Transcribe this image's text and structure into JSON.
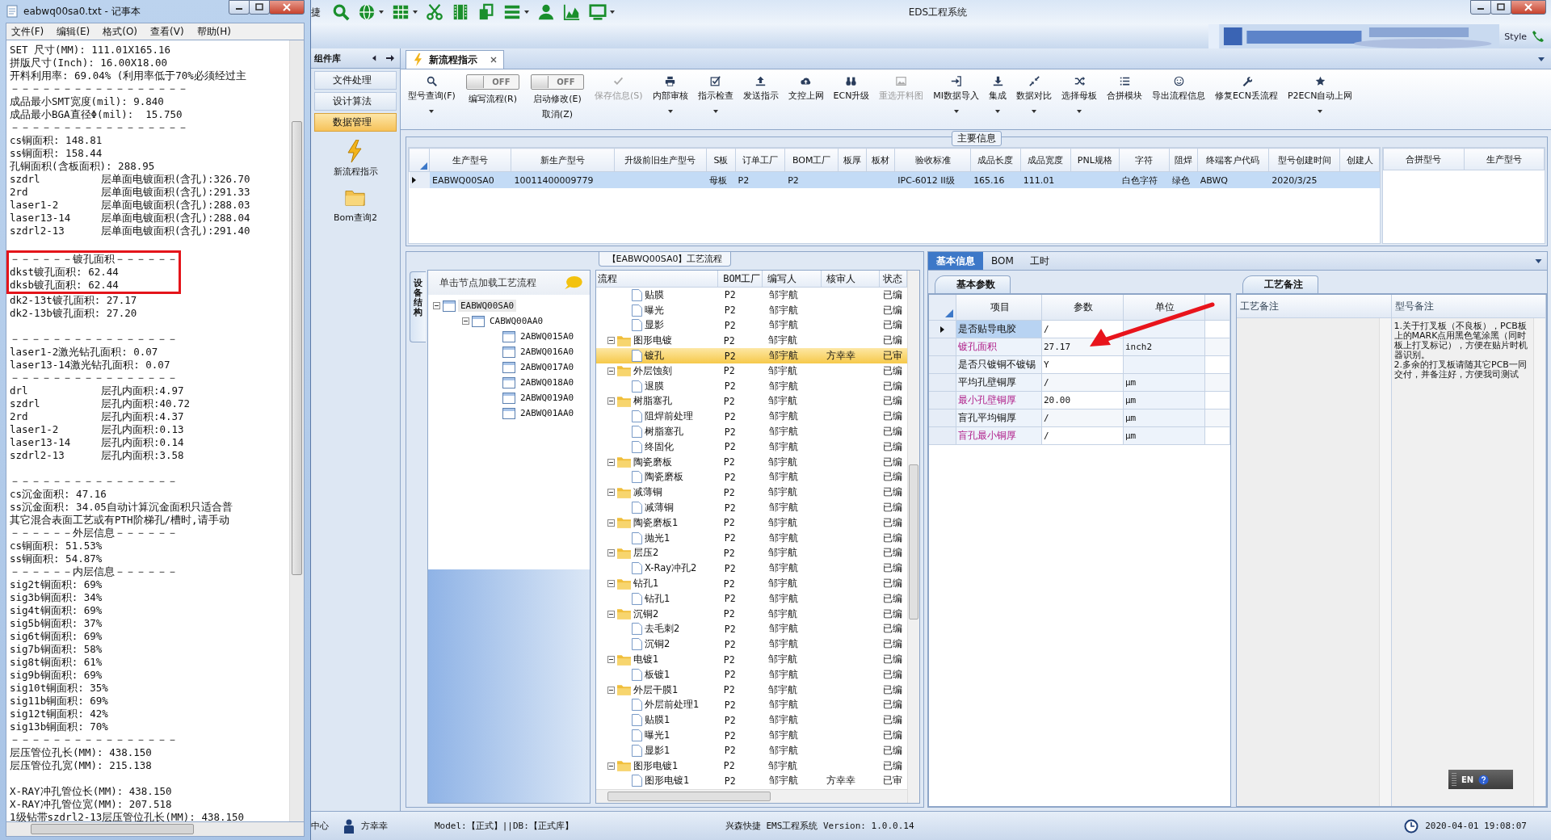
{
  "notepad": {
    "title": "eabwq00sa0.txt - 记事本",
    "menu": [
      "文件(F)",
      "编辑(E)",
      "格式(O)",
      "查看(V)",
      "帮助(H)"
    ],
    "sections": [
      {
        "gap_before": false,
        "boxed": false,
        "lines": [
          "SET 尺寸(MM): 111.01X165.16",
          "拼版尺寸(Inch): 16.00X18.00",
          "开料利用率: 69.04% (利用率低于70%必须经过主",
          "－－－－－－－－－－－－－－－－－",
          "成品最小SMT宽度(mil): 9.840",
          "成品最小BGA直径Φ(mil):  15.750",
          "－－－－－－－－－－－－－－－－－",
          "cs铜面积: 148.81",
          "ss铜面积: 158.44",
          "孔铜面积(含板面积): 288.95",
          "szdrl          层单面电镀面积(含孔):326.70",
          "2rd            层单面电镀面积(含孔):291.33",
          "laser1-2       层单面电镀面积(含孔):288.03",
          "laser13-14     层单面电镀面积(含孔):288.04",
          "szdrl2-13      层单面电镀面积(含孔):291.40"
        ]
      },
      {
        "gap_before": true,
        "boxed": true,
        "lines": [
          "－－－－－－镀孔面积－－－－－－",
          "dkst镀孔面积: 62.44",
          "dksb镀孔面积: 62.44"
        ]
      },
      {
        "gap_before": false,
        "boxed": false,
        "lines": [
          "dk2-13t镀孔面积: 27.17",
          "dk2-13b镀孔面积: 27.20"
        ]
      },
      {
        "gap_before": true,
        "boxed": false,
        "lines": [
          "－－－－－－－－－－－－－－－－",
          "laser1-2激光钻孔面积: 0.07",
          "laser13-14激光钻孔面积: 0.07",
          "－－－－－－－－－－－－－－－－",
          "drl            层孔内面积:4.97",
          "szdrl          层孔内面积:40.72",
          "2rd            层孔内面积:4.37",
          "laser1-2       层孔内面积:0.13",
          "laser13-14     层孔内面积:0.14",
          "szdrl2-13      层孔内面积:3.58"
        ]
      },
      {
        "gap_before": true,
        "boxed": false,
        "lines": [
          "－－－－－－－－－－－－－－－－",
          "cs沉金面积: 47.16",
          "ss沉金面积: 34.05自动计算沉金面积只适合普",
          "其它混合表面工艺或有PTH阶梯孔/槽时,请手动",
          "－－－－－－外层信息－－－－－－",
          "cs铜面积: 51.53%",
          "ss铜面积: 54.87%",
          "－－－－－－内层信息－－－－－－",
          "sig2t铜面积: 69%",
          "sig3b铜面积: 34%",
          "sig4t铜面积: 69%",
          "sig5b铜面积: 37%",
          "sig6t铜面积: 69%",
          "sig7b铜面积: 58%",
          "sig8t铜面积: 61%",
          "sig9b铜面积: 69%",
          "sig10t铜面积: 35%",
          "sig11b铜面积: 69%",
          "sig12t铜面积: 42%",
          "sig13b铜面积: 70%",
          "－－－－－－－－－－－－－－－－",
          "层压管位孔长(MM): 438.150",
          "层压管位孔宽(MM): 215.138"
        ]
      },
      {
        "gap_before": true,
        "boxed": false,
        "lines": [
          "X-RAY冲孔管位长(MM): 438.150",
          "X-RAY冲孔管位宽(MM): 207.518",
          "1级钻带szdrl2-13层压管位孔长(MM): 438.150"
        ]
      }
    ]
  },
  "app": {
    "title": "EDS工程系统",
    "quick_access_label": "捷",
    "style_label": "Style",
    "library": {
      "title": "组件库",
      "items": [
        {
          "label": "文件处理",
          "selected": false
        },
        {
          "label": "设计算法",
          "selected": false
        },
        {
          "label": "数据管理",
          "selected": true
        }
      ],
      "shortcuts": [
        {
          "kind": "lightning",
          "label": "新流程指示"
        },
        {
          "kind": "folder",
          "label": "Bom查询2"
        }
      ]
    },
    "doc_tabs": [
      {
        "label": "新流程指示",
        "selected": true
      }
    ],
    "ribbon": [
      {
        "kind": "button",
        "label": "型号查询(F)",
        "disabled": false,
        "dropdown": true
      },
      {
        "kind": "toggle",
        "label": "编写流程(R)",
        "switch_text": "OFF",
        "on": false
      },
      {
        "kind": "toggle",
        "label": "启动修改(E)",
        "second_label": "取消(Z)",
        "switch_text": "OFF",
        "on": false
      },
      {
        "kind": "button",
        "label": "保存信息(S)",
        "disabled": true,
        "dropdown": false
      },
      {
        "kind": "button",
        "label": "内部审核",
        "disabled": false,
        "dropdown": true
      },
      {
        "kind": "button",
        "label": "指示检查",
        "disabled": false,
        "dropdown": true
      },
      {
        "kind": "button",
        "label": "发送指示",
        "disabled": false,
        "dropdown": false
      },
      {
        "kind": "button",
        "label": "文控上网",
        "disabled": false,
        "dropdown": false
      },
      {
        "kind": "button",
        "label": "ECN升级",
        "disabled": false,
        "dropdown": false
      },
      {
        "kind": "button",
        "label": "重选开料图",
        "disabled": true,
        "dropdown": false
      },
      {
        "kind": "button",
        "label": "MI数据导入",
        "disabled": false,
        "dropdown": true
      },
      {
        "kind": "button",
        "label": "集成",
        "disabled": false,
        "dropdown": true
      },
      {
        "kind": "button",
        "label": "数据对比",
        "disabled": false,
        "dropdown": true
      },
      {
        "kind": "button",
        "label": "选择母板",
        "disabled": false,
        "dropdown": true
      },
      {
        "kind": "button",
        "label": "合拼模块",
        "disabled": false,
        "dropdown": false
      },
      {
        "kind": "button",
        "label": "导出流程信息",
        "disabled": false,
        "dropdown": false
      },
      {
        "kind": "button",
        "label": "修复ECN丢流程",
        "disabled": false,
        "dropdown": false
      },
      {
        "kind": "button",
        "label": "P2ECN自动上网",
        "disabled": false,
        "dropdown": true
      }
    ],
    "main_info": {
      "title": "主要信息",
      "columns": [
        "生产型号",
        "新生产型号",
        "升级前旧生产型号",
        "S板",
        "订单工厂",
        "BOM工厂",
        "板厚",
        "板材",
        "验收标准",
        "成品长度",
        "成品宽度",
        "PNL规格",
        "字符",
        "阻焊",
        "终端客户代码",
        "型号创建时间",
        "创建人"
      ],
      "rows": [
        {
          "selected": true,
          "cells": [
            "EABWQ00SA0",
            "10011400009779",
            null,
            "母板",
            "P2",
            "P2",
            null,
            null,
            "IPC-6012 II级",
            "165.16",
            "111.01",
            null,
            "白色字符",
            "绿色",
            "ABWQ",
            "2020/3/25",
            null
          ]
        }
      ],
      "side_columns": [
        "合拼型号",
        "生产型号"
      ]
    },
    "process": {
      "title": "【EABWQ00SA0】工艺流程",
      "side_tab": "设备结构",
      "tree_hint": "单击节点加载工艺流程",
      "tree": [
        {
          "label": "EABWQ00SA0",
          "selected": true,
          "expanded": true,
          "children": [
            {
              "label": "CABWQ00AA0",
              "selected": false,
              "expanded": true,
              "children": [
                {
                  "label": "2ABWQ015A0",
                  "selected": false
                },
                {
                  "label": "2ABWQ016A0",
                  "selected": false
                },
                {
                  "label": "2ABWQ017A0",
                  "selected": false
                },
                {
                  "label": "2ABWQ018A0",
                  "selected": false
                },
                {
                  "label": "2ABWQ019A0",
                  "selected": false
                },
                {
                  "label": "2ABWQ01AA0",
                  "selected": false
                }
              ]
            }
          ]
        }
      ],
      "columns": [
        "流程",
        "BOM工厂",
        "编写人",
        "核审人",
        "状态"
      ],
      "rows": [
        {
          "kind": "step",
          "name": "贴膜",
          "factory": "P2",
          "writer": "邹宇航",
          "status": "已编",
          "selected": false
        },
        {
          "kind": "step",
          "name": "曝光",
          "factory": "P2",
          "writer": "邹宇航",
          "status": "已编",
          "selected": false
        },
        {
          "kind": "step",
          "name": "显影",
          "factory": "P2",
          "writer": "邹宇航",
          "status": "已编",
          "selected": false
        },
        {
          "kind": "group",
          "name": "图形电镀",
          "factory": "P2",
          "writer": "邹宇航",
          "status": "已编",
          "selected": false,
          "expanded": true,
          "children": [
            {
              "name": "镀孔",
              "factory": "P2",
              "writer": "邹宇航",
              "reviewer": "方幸幸",
              "status": "已审",
              "selected": true
            }
          ]
        },
        {
          "kind": "group",
          "name": "外层蚀刻",
          "factory": "P2",
          "writer": "邹宇航",
          "status": "已编",
          "selected": false,
          "expanded": true,
          "children": [
            {
              "name": "退膜",
              "factory": "P2",
              "writer": "邹宇航",
              "status": "已编",
              "selected": false
            }
          ]
        },
        {
          "kind": "group",
          "name": "树脂塞孔",
          "factory": "P2",
          "writer": "邹宇航",
          "status": "已编",
          "selected": false,
          "expanded": true,
          "children": [
            {
              "name": "阻焊前处理",
              "factory": "P2",
              "writer": "邹宇航",
              "status": "已编",
              "selected": false
            },
            {
              "name": "树脂塞孔",
              "factory": "P2",
              "writer": "邹宇航",
              "status": "已编",
              "selected": false
            },
            {
              "name": "终固化",
              "factory": "P2",
              "writer": "邹宇航",
              "status": "已编",
              "selected": false
            }
          ]
        },
        {
          "kind": "group",
          "name": "陶瓷磨板",
          "factory": "P2",
          "writer": "邹宇航",
          "status": "已编",
          "selected": false,
          "expanded": true,
          "children": [
            {
              "name": "陶瓷磨板",
              "factory": "P2",
              "writer": "邹宇航",
              "status": "已编",
              "selected": false
            }
          ]
        },
        {
          "kind": "group",
          "name": "减薄铜",
          "factory": "P2",
          "writer": "邹宇航",
          "status": "已编",
          "selected": false,
          "expanded": true,
          "children": [
            {
              "name": "减薄铜",
              "factory": "P2",
              "writer": "邹宇航",
              "status": "已编",
              "selected": false
            }
          ]
        },
        {
          "kind": "group",
          "name": "陶瓷磨板1",
          "factory": "P2",
          "writer": "邹宇航",
          "status": "已编",
          "selected": false,
          "expanded": true,
          "children": [
            {
              "name": "抛光1",
              "factory": "P2",
              "writer": "邹宇航",
              "status": "已编",
              "selected": false
            }
          ]
        },
        {
          "kind": "group",
          "name": "层压2",
          "factory": "P2",
          "writer": "邹宇航",
          "status": "已编",
          "selected": false,
          "expanded": true,
          "children": [
            {
              "name": "X-Ray冲孔2",
              "factory": "P2",
              "writer": "邹宇航",
              "status": "已编",
              "selected": false
            }
          ]
        },
        {
          "kind": "group",
          "name": "钻孔1",
          "factory": "P2",
          "writer": "邹宇航",
          "status": "已编",
          "selected": false,
          "expanded": true,
          "children": [
            {
              "name": "钻孔1",
              "factory": "P2",
              "writer": "邹宇航",
              "status": "已编",
              "selected": false
            }
          ]
        },
        {
          "kind": "group",
          "name": "沉铜2",
          "factory": "P2",
          "writer": "邹宇航",
          "status": "已编",
          "selected": false,
          "expanded": true,
          "children": [
            {
              "name": "去毛刺2",
              "factory": "P2",
              "writer": "邹宇航",
              "status": "已编",
              "selected": false
            },
            {
              "name": "沉铜2",
              "factory": "P2",
              "writer": "邹宇航",
              "status": "已编",
              "selected": false
            }
          ]
        },
        {
          "kind": "group",
          "name": "电镀1",
          "factory": "P2",
          "writer": "邹宇航",
          "status": "已编",
          "selected": false,
          "expanded": true,
          "children": [
            {
              "name": "板镀1",
              "factory": "P2",
              "writer": "邹宇航",
              "status": "已编",
              "selected": false
            }
          ]
        },
        {
          "kind": "group",
          "name": "外层干膜1",
          "factory": "P2",
          "writer": "邹宇航",
          "status": "已编",
          "selected": false,
          "expanded": true,
          "children": [
            {
              "name": "外层前处理1",
              "factory": "P2",
              "writer": "邹宇航",
              "status": "已编",
              "selected": false
            },
            {
              "name": "贴膜1",
              "factory": "P2",
              "writer": "邹宇航",
              "status": "已编",
              "selected": false
            },
            {
              "name": "曝光1",
              "factory": "P2",
              "writer": "邹宇航",
              "status": "已编",
              "selected": false
            },
            {
              "name": "显影1",
              "factory": "P2",
              "writer": "邹宇航",
              "status": "已编",
              "selected": false
            }
          ]
        },
        {
          "kind": "group",
          "name": "图形电镀1",
          "factory": "P2",
          "writer": "邹宇航",
          "status": "已编",
          "selected": false,
          "expanded": true,
          "children": [
            {
              "name": "图形电镀1",
              "factory": "P2",
              "writer": "邹宇航",
              "reviewer": "方幸幸",
              "status": "已审",
              "selected": false
            }
          ]
        }
      ]
    },
    "detail": {
      "tabs": [
        {
          "label": "基本信息",
          "selected": true
        },
        {
          "label": "BOM",
          "selected": false
        },
        {
          "label": "工时",
          "selected": false
        }
      ],
      "params": {
        "title": "基本参数",
        "columns": [
          "项目",
          "参数",
          "单位"
        ],
        "rows": [
          {
            "item": "是否贴导电胶",
            "value": "/",
            "emphasized": false,
            "selected": true
          },
          {
            "item": "镀孔面积",
            "value": "27.17",
            "unit": "inch2",
            "emphasized": true,
            "selected": false
          },
          {
            "item": "是否只镀铜不镀锡",
            "value": "Y",
            "emphasized": false,
            "selected": false
          },
          {
            "item": "平均孔壁铜厚",
            "value": "/",
            "unit": "μm",
            "emphasized": false,
            "selected": false
          },
          {
            "item": "最小孔壁铜厚",
            "value": "20.00",
            "unit": "μm",
            "emphasized": true,
            "selected": false
          },
          {
            "item": "盲孔平均铜厚",
            "value": "/",
            "unit": "μm",
            "emphasized": false,
            "selected": false
          },
          {
            "item": "盲孔最小铜厚",
            "value": "/",
            "unit": "μm",
            "emphasized": true,
            "selected": false
          }
        ]
      },
      "remarks": {
        "title": "工艺备注",
        "columns": [
          "工艺备注",
          "型号备注"
        ],
        "model_note": "1.关于打叉板（不良板），PCB板上的MARK点用黑色笔涂黑（同时板上打叉标记），方便在贴片时机器识别。\n2.多余的打叉板请随其它PCB一同交付，并备注好，方便我司测试"
      }
    },
    "ime": {
      "label": "EN"
    },
    "status_bar": {
      "left": "中心",
      "user": "方幸幸",
      "model": "Model:【正式】||DB:【正式库】",
      "product": "兴森快捷 EMS工程系统 Version: 1.0.0.14",
      "datetime": "2020-04-01 19:08:07"
    }
  }
}
